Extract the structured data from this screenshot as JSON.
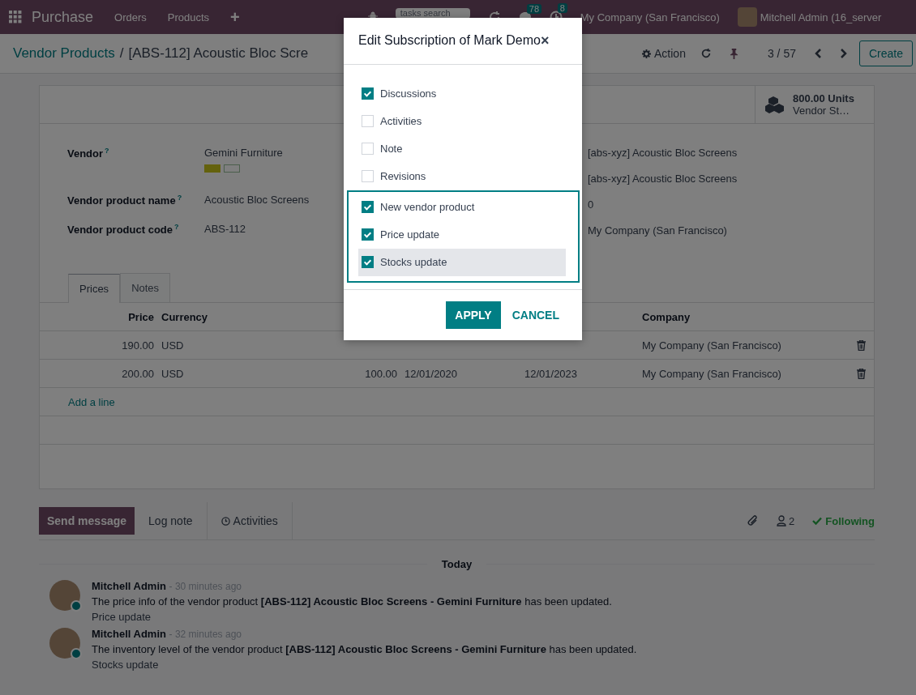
{
  "navbar": {
    "app": "Purchase",
    "menus": [
      "Orders",
      "Products"
    ],
    "add": "+",
    "search": {
      "placeholder": "tasks search"
    },
    "messages_badge": "78",
    "activities_badge": "8",
    "company": "My Company (San Francisco)",
    "user": "Mitchell Admin (16_server"
  },
  "control_panel": {
    "breadcrumb": "Vendor Products",
    "separator": "/",
    "current": "[ABS-112] Acoustic Bloc Scre",
    "action": "Action",
    "pager": "3 / 57",
    "create": "Create"
  },
  "stat_button": {
    "value": "800.00 Units",
    "label": "Vendor St…"
  },
  "fields": [
    {
      "label": "Vendor",
      "help": "?",
      "value": "Gemini Furniture",
      "kind": "tags"
    },
    {
      "label": "Vendor product name",
      "help": "?",
      "value": "Acoustic Bloc Screens",
      "kind": "text"
    },
    {
      "label": "Vendor product code",
      "help": "?",
      "value": "ABS-112",
      "kind": "text"
    }
  ],
  "right_fields": [
    "[abs-xyz] Acoustic Bloc Screens",
    "[abs-xyz] Acoustic Bloc Screens",
    "0",
    "My Company (San Francisco)"
  ],
  "tabs": [
    {
      "label": "Prices",
      "selected": true
    },
    {
      "label": "Notes",
      "selected": false
    }
  ],
  "table": {
    "columns": [
      "Price",
      "Currency",
      "Company"
    ],
    "rows": [
      {
        "price": "190.00",
        "currency": "USD",
        "company": "My Company (San Francisco)"
      },
      {
        "price": "200.00",
        "currency": "USD",
        "quantity": "100.00",
        "start": "12/01/2020",
        "end": "12/01/2023",
        "company": "My Company (San Francisco)"
      }
    ],
    "add_line": "Add a line"
  },
  "chatter": {
    "send": "Send message",
    "log": "Log note",
    "activities": "Activities",
    "followers": "2",
    "following": "Following",
    "day": "Today",
    "messages": [
      {
        "author": "Mitchell Admin",
        "time": "- 30 minutes ago",
        "body": "The price info of the vendor product **[ABS-112] Acoustic Bloc Screens - Gemini Furniture** has been updated.",
        "note": "Price update"
      },
      {
        "author": "Mitchell Admin",
        "time": "- 32 minutes ago",
        "body": "The inventory level of the vendor product **[ABS-112] Acoustic Bloc Screens - Gemini Furniture** has been updated.",
        "note": "Stocks update"
      }
    ]
  },
  "dialog": {
    "title": "Edit Subscription of Mark Demo",
    "close": "×",
    "groups": [
      {
        "framed": false,
        "options": [
          {
            "label": "Discussions",
            "checked": true,
            "hovered": false
          },
          {
            "label": "Activities",
            "checked": false,
            "hovered": false
          },
          {
            "label": "Note",
            "checked": false,
            "hovered": false
          },
          {
            "label": "Revisions",
            "checked": false,
            "hovered": false
          }
        ]
      },
      {
        "framed": true,
        "options": [
          {
            "label": "New vendor product",
            "checked": true,
            "hovered": false
          },
          {
            "label": "Price update",
            "checked": true,
            "hovered": false
          },
          {
            "label": "Stocks update",
            "checked": true,
            "hovered": true
          }
        ]
      }
    ],
    "apply": "APPLY",
    "cancel": "CANCEL"
  }
}
